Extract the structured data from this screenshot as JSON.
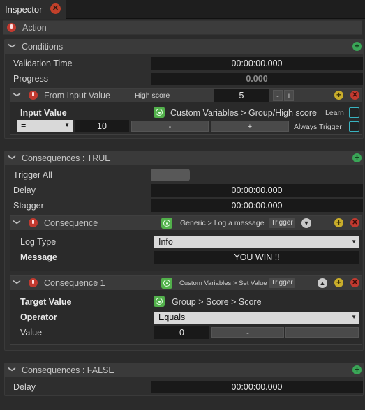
{
  "tab": {
    "title": "Inspector",
    "close": "✕"
  },
  "action": {
    "label": "Action"
  },
  "conditions": {
    "title": "Conditions",
    "validation_label": "Validation Time",
    "validation_value": "00:00:00.000",
    "progress_label": "Progress",
    "progress_value": "0.000",
    "from_input": {
      "title": "From Input Value",
      "param_label": "High score",
      "param_value": "5",
      "minus": "-",
      "plus": "+",
      "input_label": "Input Value",
      "target_path": "Custom Variables > Group/High score",
      "learn": "Learn",
      "comparator": "=",
      "compare_value": "10",
      "compare_minus": "-",
      "compare_plus": "+",
      "always_trigger": "Always Trigger"
    }
  },
  "consequences_true": {
    "title": "Consequences : TRUE",
    "trigger_all": "Trigger All",
    "delay_label": "Delay",
    "delay_value": "00:00:00.000",
    "stagger_label": "Stagger",
    "stagger_value": "00:00:00.000",
    "consequence": {
      "title": "Consequence",
      "path": "Generic > Log a message",
      "trigger": "Trigger",
      "log_type_label": "Log Type",
      "log_type_value": "Info",
      "message_label": "Message",
      "message_value": "YOU WIN !!"
    },
    "consequence1": {
      "title": "Consequence 1",
      "path": "Custom Variables > Set Value",
      "trigger": "Trigger",
      "target_label": "Target Value",
      "target_value": "Group > Score > Score",
      "operator_label": "Operator",
      "operator_value": "Equals",
      "value_label": "Value",
      "value_value": "0",
      "minus": "-",
      "plus": "+"
    }
  },
  "consequences_false": {
    "title": "Consequences : FALSE",
    "delay_label": "Delay",
    "delay_value": "00:00:00.000"
  },
  "icons": {
    "chevron": "❯",
    "plus": "+",
    "x": "✕",
    "chevron_up": "▲",
    "chevron_down": "▼",
    "dropdown_arrow": "▼"
  },
  "colors": {
    "power_red": "#c23a30",
    "add_green": "#3aa657",
    "add_yellow": "#c9ad2b",
    "target_green": "#52b04b",
    "checkbox_cyan": "#39b3c0"
  }
}
